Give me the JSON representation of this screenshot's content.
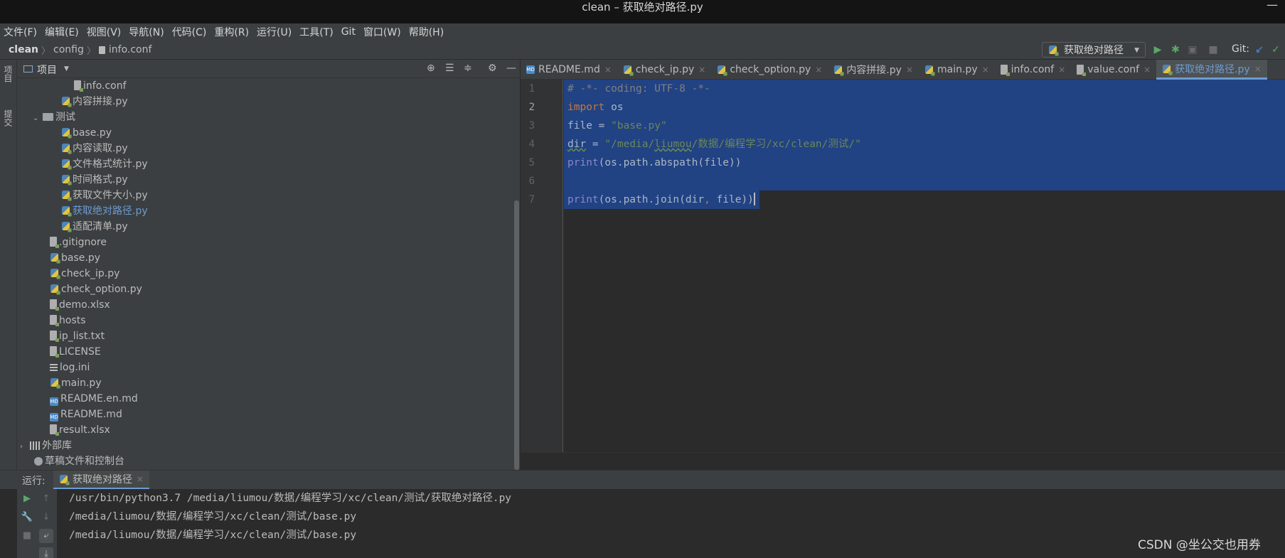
{
  "window": {
    "title": "clean – 获取绝对路径.py",
    "minimize_glyph": "—"
  },
  "menu": [
    "文件(F)",
    "编辑(E)",
    "视图(V)",
    "导航(N)",
    "代码(C)",
    "重构(R)",
    "运行(U)",
    "工具(T)",
    "Git",
    "窗口(W)",
    "帮助(H)"
  ],
  "breadcrumb": {
    "project": "clean",
    "folder": "config",
    "file": "info.conf"
  },
  "toolbar": {
    "run_config": "获取绝对路径",
    "git_label": "Git:"
  },
  "side_strip": {
    "project_tab": "项目",
    "commit_tab": "提交"
  },
  "project_panel": {
    "title": "项目",
    "tree": [
      {
        "label": "info.conf",
        "icon": "text-file-icon",
        "depth": 4
      },
      {
        "label": "内容拼接.py",
        "icon": "python-file-icon",
        "depth": 3
      },
      {
        "label": "测试",
        "icon": "folder-icon",
        "depth": 2,
        "expanded": true
      },
      {
        "label": "base.py",
        "icon": "python-file-icon",
        "depth": 3
      },
      {
        "label": "内容读取.py",
        "icon": "python-file-icon",
        "depth": 3
      },
      {
        "label": "文件格式统计.py",
        "icon": "python-file-icon",
        "depth": 3
      },
      {
        "label": "时间格式.py",
        "icon": "python-file-icon",
        "depth": 3
      },
      {
        "label": "获取文件大小.py",
        "icon": "python-file-icon",
        "depth": 3
      },
      {
        "label": "获取绝对路径.py",
        "icon": "python-file-icon",
        "depth": 3,
        "selected": true
      },
      {
        "label": "适配清单.py",
        "icon": "python-file-icon",
        "depth": 3
      },
      {
        "label": ".gitignore",
        "icon": "text-file-icon",
        "depth": 2
      },
      {
        "label": "base.py",
        "icon": "python-file-icon",
        "depth": 2
      },
      {
        "label": "check_ip.py",
        "icon": "python-file-icon",
        "depth": 2
      },
      {
        "label": "check_option.py",
        "icon": "python-file-icon",
        "depth": 2
      },
      {
        "label": "demo.xlsx",
        "icon": "text-file-icon",
        "depth": 2
      },
      {
        "label": "hosts",
        "icon": "text-file-icon",
        "depth": 2
      },
      {
        "label": "ip_list.txt",
        "icon": "text-file-icon",
        "depth": 2
      },
      {
        "label": "LICENSE",
        "icon": "text-file-icon",
        "depth": 2
      },
      {
        "label": "log.ini",
        "icon": "config-lines-icon",
        "depth": 2
      },
      {
        "label": "main.py",
        "icon": "python-file-icon",
        "depth": 2
      },
      {
        "label": "README.en.md",
        "icon": "markdown-file-icon",
        "depth": 2
      },
      {
        "label": "README.md",
        "icon": "markdown-file-icon",
        "depth": 2
      },
      {
        "label": "result.xlsx",
        "icon": "text-file-icon",
        "depth": 2
      },
      {
        "label": "外部库",
        "icon": "library-icon",
        "depth": 0,
        "collapsed": true
      },
      {
        "label": "草稿文件和控制台",
        "icon": "scratch-icon",
        "depth": 1
      }
    ]
  },
  "editor_tabs": [
    {
      "label": "README.md",
      "icon": "markdown-file-icon"
    },
    {
      "label": "check_ip.py",
      "icon": "python-file-icon"
    },
    {
      "label": "check_option.py",
      "icon": "python-file-icon"
    },
    {
      "label": "内容拼接.py",
      "icon": "python-file-icon"
    },
    {
      "label": "main.py",
      "icon": "python-file-icon"
    },
    {
      "label": "info.conf",
      "icon": "text-file-icon"
    },
    {
      "label": "value.conf",
      "icon": "text-file-icon"
    },
    {
      "label": "获取绝对路径.py",
      "icon": "python-file-icon",
      "active": true
    }
  ],
  "editor": {
    "current_line": 2,
    "lines": [
      {
        "no": "1",
        "tokens": [
          {
            "t": "# -*- coding: UTF-8 -*-",
            "c": "com"
          }
        ]
      },
      {
        "no": "2",
        "tokens": [
          {
            "t": "import",
            "c": "kw"
          },
          {
            "t": " os",
            "c": ""
          }
        ]
      },
      {
        "no": "3",
        "tokens": [
          {
            "t": "file = ",
            "c": ""
          },
          {
            "t": "\"base.py\"",
            "c": "str"
          }
        ]
      },
      {
        "no": "4",
        "tokens": [
          {
            "t": "dir",
            "c": "wavy"
          },
          {
            "t": " = ",
            "c": ""
          },
          {
            "t": "\"/media/",
            "c": "str"
          },
          {
            "t": "liumou",
            "c": "str wavy"
          },
          {
            "t": "/数据/编程学习/xc/clean/测试/\"",
            "c": "str"
          }
        ]
      },
      {
        "no": "5",
        "tokens": [
          {
            "t": "print",
            "c": "fn"
          },
          {
            "t": "(os.path.abspath(file))",
            "c": ""
          }
        ]
      },
      {
        "no": "6",
        "tokens": []
      },
      {
        "no": "7",
        "tokens": [
          {
            "t": "print",
            "c": "fn"
          },
          {
            "t": "(os.path.join(dir",
            "c": ""
          },
          {
            "t": ",",
            "c": "kw"
          },
          {
            "t": " file))",
            "c": ""
          }
        ]
      }
    ]
  },
  "run": {
    "label": "运行:",
    "tab": "获取绝对路径",
    "output": [
      "/usr/bin/python3.7 /media/liumou/数据/编程学习/xc/clean/测试/获取绝对路径.py",
      "/media/liumou/数据/编程学习/xc/clean/测试/base.py",
      "/media/liumou/数据/编程学习/xc/clean/测试/base.py"
    ]
  },
  "watermark": "CSDN @坐公交也用券",
  "colors": {
    "accent": "#6c9bd2",
    "selection": "#214283",
    "keyword": "#cc7832",
    "string": "#6a8759",
    "comment": "#808080",
    "builtin": "#8888c6",
    "run_green": "#59a869"
  }
}
